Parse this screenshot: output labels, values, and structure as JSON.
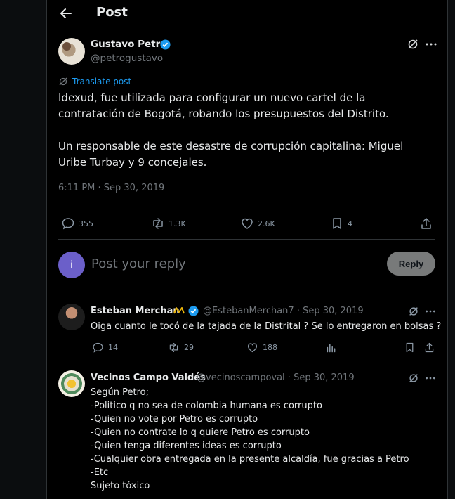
{
  "header": {
    "title": "Post"
  },
  "post": {
    "author_name": "Gustavo Petro",
    "author_handle": "@petrogustavo",
    "translate_label": "Translate post",
    "text": "Idexud, fue utilizada para configurar un nuevo cartel de la contratación de Bogotá, robando los presupuestos del Distrito.\n\nUn responsable de este desastre de corrupción capitalina: Miguel Uribe Turbay y 9 concejales.",
    "timestamp": "6:11 PM · Sep 30, 2019",
    "stats": {
      "replies": "355",
      "reposts": "1.3K",
      "likes": "2.6K",
      "bookmarks": "4"
    }
  },
  "reply_box": {
    "avatar_letter": "i",
    "placeholder": "Post your reply",
    "button_label": "Reply"
  },
  "replies": [
    {
      "name": "Esteban Merchan",
      "handle_date": "@EstebanMerchan7 · Sep 30, 2019",
      "text": "Oiga cuanto le tocó de la tajada de la Distrital ? Se lo entregaron en bolsas ?",
      "replies": "14",
      "reposts": "29",
      "likes": "188"
    },
    {
      "name": "Vecinos Campo Valdés",
      "handle_date": "@vecinoscampoval · Sep 30, 2019",
      "text": "Según Petro;\n-Politico q no sea de colombia humana es corrupto\n-Quien no vote por Petro es corrupto\n-Quien no contrate lo q quiere Petro es corrupto\n-Quien tenga diferentes ideas es corrupto\n-Cualquier obra entregada en la presente alcaldía, fue gracias a Petro\n-Etc\nSujeto tóxico"
    }
  ],
  "colors": {
    "link": "#1d9bf0",
    "verified": "#1d9bf0",
    "muted": "#71767b",
    "reply_avatar": "#6b5fc9"
  }
}
